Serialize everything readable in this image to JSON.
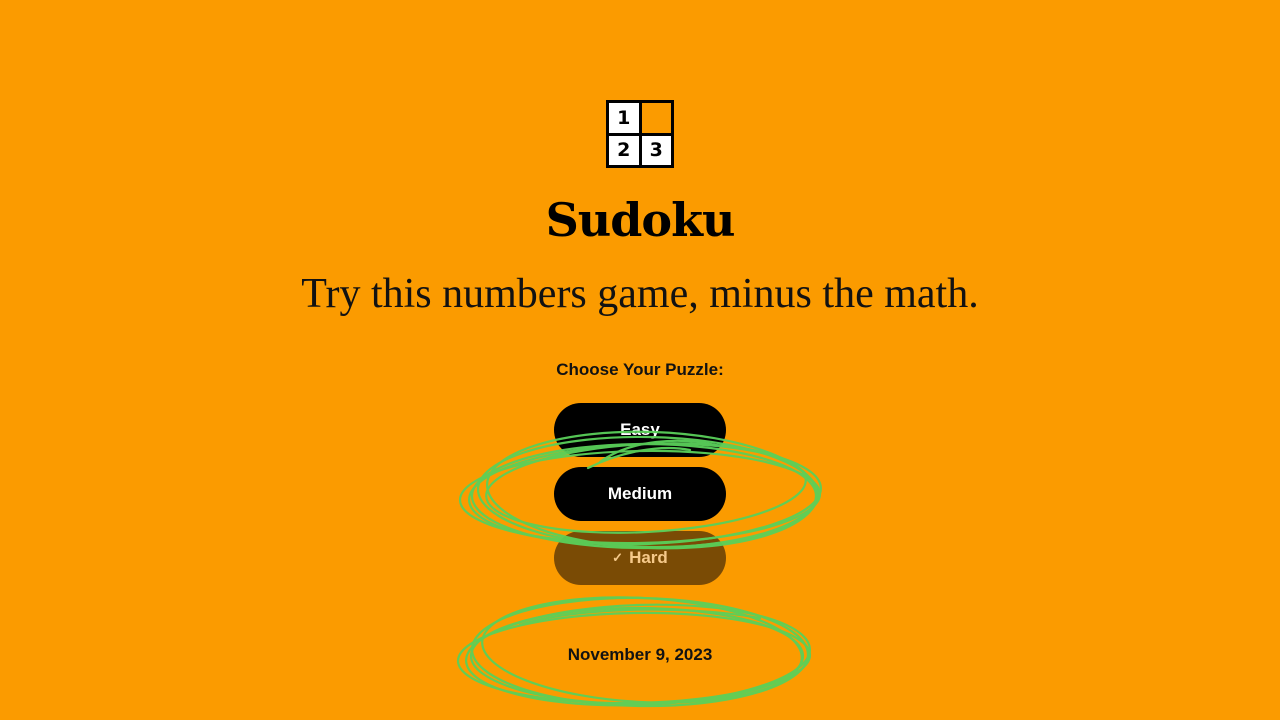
{
  "logo": {
    "cells": [
      "1",
      "",
      "2",
      "3"
    ]
  },
  "header": {
    "title": "Sudoku",
    "subtitle": "Try this numbers game, minus the math."
  },
  "puzzle_picker": {
    "label": "Choose Your Puzzle:",
    "options": [
      {
        "label": "Easy",
        "selected": false
      },
      {
        "label": "Medium",
        "selected": false
      },
      {
        "label": "Hard",
        "selected": true
      }
    ],
    "check_mark": "✓"
  },
  "date": "November 9, 2023",
  "colors": {
    "background": "#FB9B00",
    "button": "#000000",
    "selected_button": "#7A4B05",
    "annotation": "#5AD05A"
  }
}
